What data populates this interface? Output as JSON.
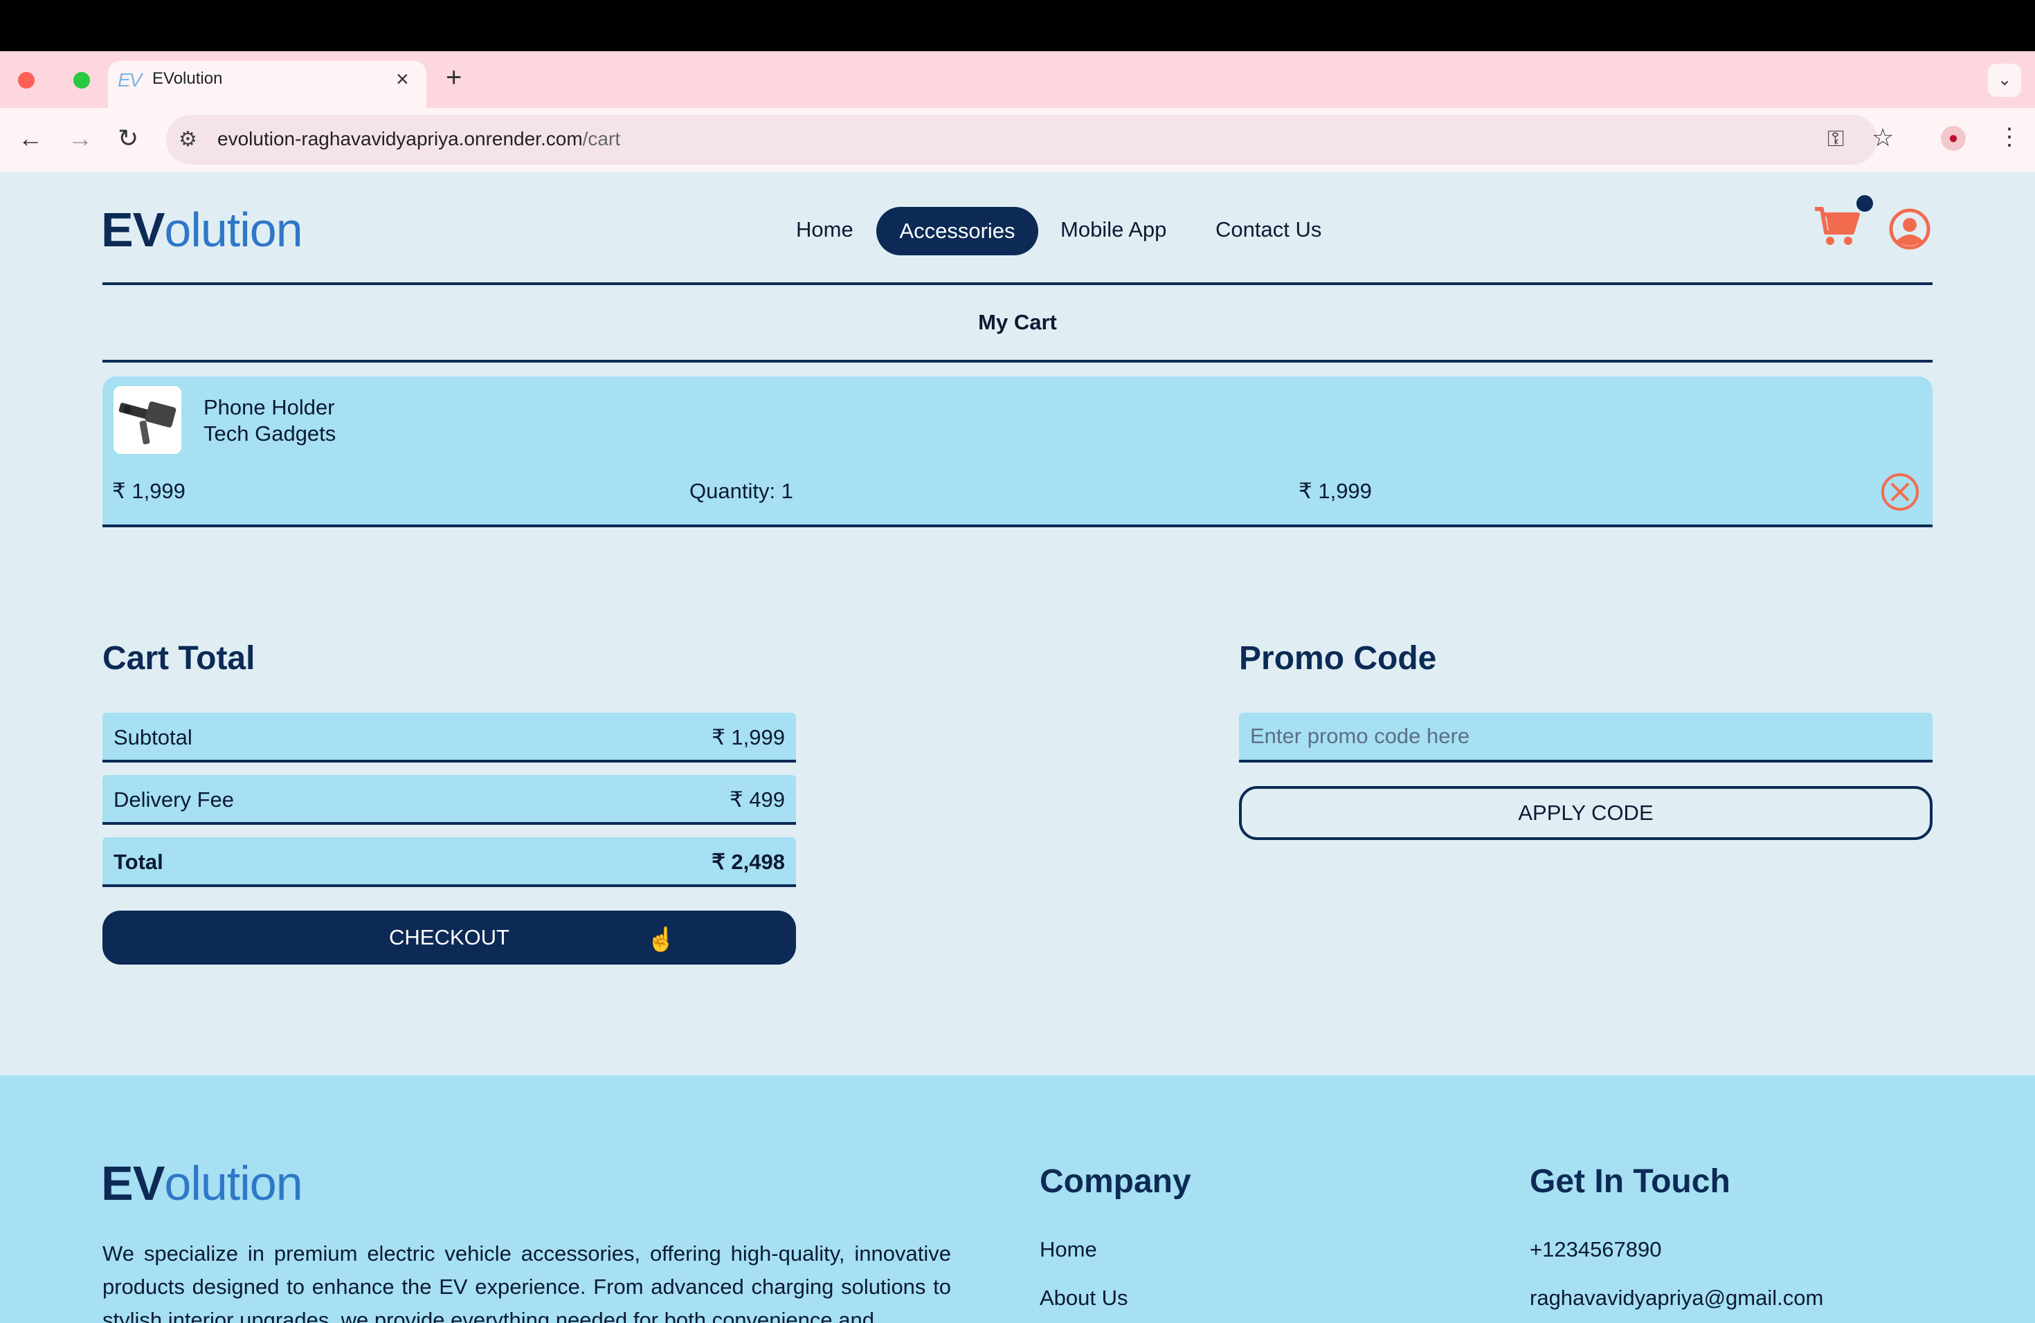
{
  "browser": {
    "tab_favicon": "EV",
    "tab_title": "EVolution",
    "tab_close": "×",
    "new_tab": "+",
    "tab_menu": "⌄",
    "url_host": "evolution-raghavavidyapriya.onrender.com",
    "url_path": "/cart"
  },
  "header": {
    "logo_ev": "EV",
    "logo_rest": "olution",
    "nav": [
      "Home",
      "Accessories",
      "Mobile App",
      "Contact Us"
    ],
    "active_nav": "Accessories",
    "colors": {
      "primary": "#0c2a55",
      "accent": "#f26b4f",
      "card": "#a6e0f2",
      "page_bg": "#e0eef4"
    }
  },
  "cart": {
    "title": "My Cart",
    "items": [
      {
        "name": "Phone Holder",
        "category": "Tech Gadgets",
        "price": "₹ 1,999",
        "quantity": "Quantity: 1",
        "total": "₹ 1,999"
      }
    ]
  },
  "totals": {
    "title": "Cart Total",
    "rows": [
      {
        "label": "Subtotal",
        "value": "₹ 1,999"
      },
      {
        "label": "Delivery Fee",
        "value": "₹ 499"
      },
      {
        "label": "Total",
        "value": "₹ 2,498"
      }
    ],
    "checkout_label": "CHECKOUT"
  },
  "promo": {
    "title": "Promo Code",
    "placeholder": "Enter promo code here",
    "apply_label": "APPLY CODE"
  },
  "footer": {
    "logo_ev": "EV",
    "logo_rest": "olution",
    "description": "We specialize in premium electric vehicle accessories, offering high-quality, innovative products designed to enhance the EV experience. From advanced charging solutions to stylish interior upgrades, we provide everything needed for both convenience and",
    "company_title": "Company",
    "company_links": [
      "Home",
      "About Us"
    ],
    "contact_title": "Get In Touch",
    "phone": "+1234567890",
    "email": "raghavavidyapriya@gmail.com"
  }
}
